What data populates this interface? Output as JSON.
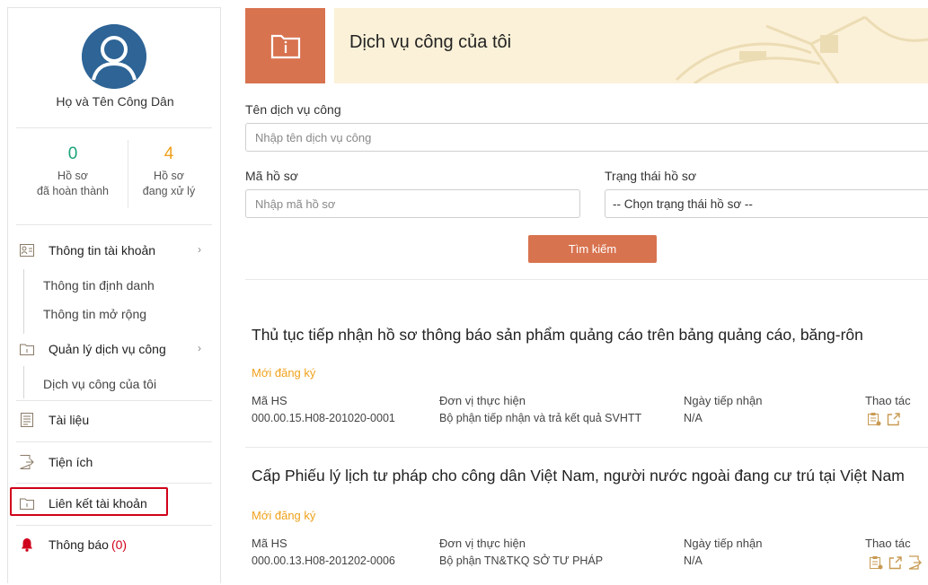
{
  "sidebar": {
    "user_name": "Họ và Tên Công Dân",
    "stats": [
      {
        "value": "0",
        "label_line1": "Hồ sơ",
        "label_line2": "đã hoàn thành"
      },
      {
        "value": "4",
        "label_line1": "Hồ sơ",
        "label_line2": "đang xử lý"
      }
    ],
    "menu": {
      "account_info": "Thông tin tài khoản",
      "identity_info": "Thông tin định danh",
      "extended_info": "Thông tin mở rộng",
      "service_mgmt": "Quản lý dịch vụ công",
      "my_services": "Dịch vụ công của tôi",
      "documents": "Tài liệu",
      "utilities": "Tiện ích",
      "account_link": "Liên kết tài khoản",
      "notifications": "Thông báo",
      "notification_count": "(0)"
    }
  },
  "header": {
    "title": "Dịch vụ công của tôi"
  },
  "form": {
    "service_name_label": "Tên dịch vụ công",
    "service_name_placeholder": "Nhập tên dịch vụ công",
    "file_code_label": "Mã hồ sơ",
    "file_code_placeholder": "Nhập mã hồ sơ",
    "status_label": "Trạng thái hồ sơ",
    "status_selected": "-- Chọn trạng thái hồ sơ --",
    "search_button": "Tìm kiếm"
  },
  "columns": {
    "code": "Mã HS",
    "unit": "Đơn vị thực hiện",
    "date": "Ngày tiếp nhận",
    "actions": "Thao tác"
  },
  "records": [
    {
      "title": "Thủ tục tiếp nhận hồ sơ thông báo sản phẩm quảng cáo trên bảng quảng cáo, băng-rôn",
      "status": "Mới đăng ký",
      "code": "000.00.15.H08-201020-0001",
      "unit": "Bộ phận tiếp nhận và trả kết quả SVHTT",
      "date": "N/A"
    },
    {
      "title": "Cấp Phiếu lý lịch tư pháp cho công dân Việt Nam, người nước ngoài đang cư trú tại Việt Nam",
      "status": "Mới đăng ký",
      "code": "000.00.13.H08-201202-0006",
      "unit": "Bộ phận TN&TKQ SỞ TƯ PHÁP",
      "date": "N/A"
    }
  ],
  "colors": {
    "accent": "#d8734f",
    "banner": "#fbf1d8",
    "avatar": "#2e6496",
    "done": "#1aa37a",
    "pending": "#f0a11c",
    "highlight": "#d0021b"
  },
  "icons": {
    "avatar": "user-avatar-icon",
    "account": "id-card-icon",
    "folder": "folder-icon",
    "documents": "document-icon",
    "utilities": "file-export-icon",
    "bell": "bell-icon",
    "view": "clipboard-icon",
    "share": "share-icon"
  }
}
